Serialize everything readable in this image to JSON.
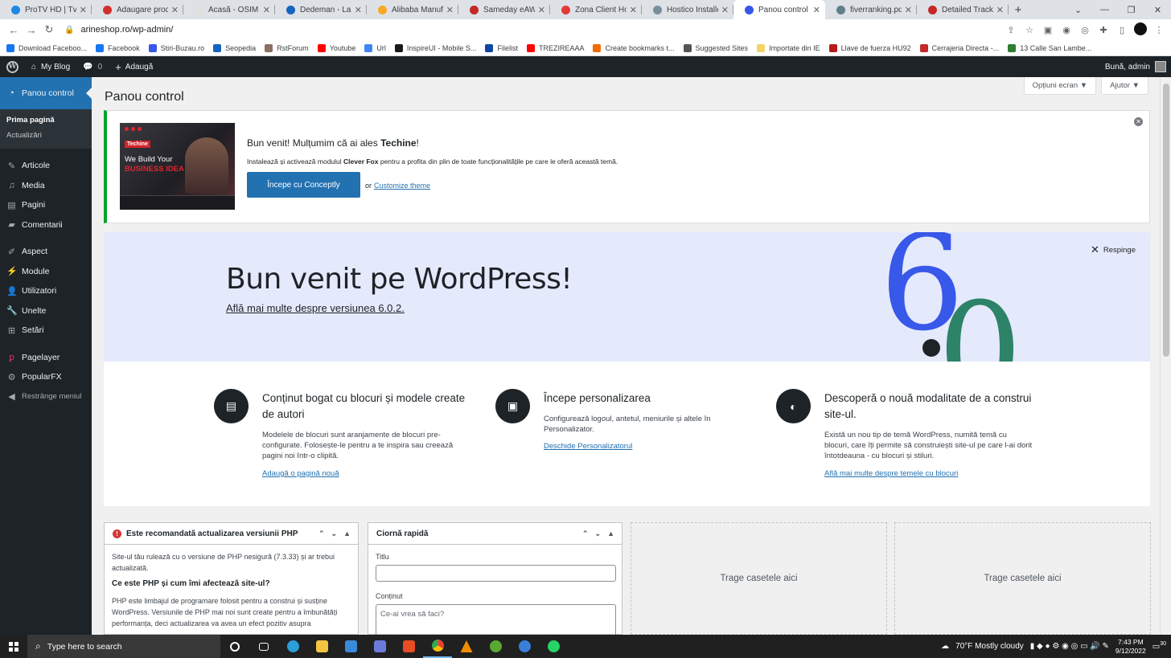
{
  "browser": {
    "tabs": [
      {
        "label": "ProTV HD | Tv Online",
        "color": "#1e88e5"
      },
      {
        "label": "Adaugare produs",
        "color": "#d32f2f"
      },
      {
        "label": "Acasă - OSIM - Of",
        "color": "#e0e0e0"
      },
      {
        "label": "Dedeman - Lamp",
        "color": "#1565c0"
      },
      {
        "label": "Alibaba Manufact",
        "color": "#f9a825"
      },
      {
        "label": "Sameday eAWB",
        "color": "#c62828"
      },
      {
        "label": "Zona Client Hostic",
        "color": "#e53935"
      },
      {
        "label": "Hostico Installer",
        "color": "#78909c"
      },
      {
        "label": "Panou control ‹ M",
        "color": "#3858e9",
        "active": true
      },
      {
        "label": "fiverranking.pdf",
        "color": "#607d8b"
      },
      {
        "label": "Detailed Tracking",
        "color": "#c62828"
      }
    ],
    "new_tab": "+",
    "url": "arineshop.ro/wp-admin/",
    "bookmarks": [
      {
        "label": "Download Faceboo...",
        "color": "#1877f2"
      },
      {
        "label": "Facebook",
        "color": "#1877f2"
      },
      {
        "label": "Stiri-Buzau.ro",
        "color": "#3858e9"
      },
      {
        "label": "Seopedia",
        "color": "#1565c0"
      },
      {
        "label": "RstForum",
        "color": "#8d6e63"
      },
      {
        "label": "Youtube",
        "color": "#ff0000"
      },
      {
        "label": "Url",
        "color": "#4285f4"
      },
      {
        "label": "InspireUI - Mobile S...",
        "color": "#1a1a1a"
      },
      {
        "label": "Filelist",
        "color": "#0d47a1"
      },
      {
        "label": "TREZIREAAA",
        "color": "#ff0000"
      },
      {
        "label": "Create bookmarks t...",
        "color": "#ef6c00"
      },
      {
        "label": "Suggested Sites",
        "color": "#555555"
      },
      {
        "label": "Importate din IE",
        "color": "#f6d365"
      },
      {
        "label": "Llave de fuerza HU92",
        "color": "#b71c1c"
      },
      {
        "label": "Cerrajeria Directa -...",
        "color": "#c62828"
      },
      {
        "label": "13 Calle San Lambe...",
        "color": "#2e7d32"
      }
    ]
  },
  "adminbar": {
    "site_name": "My Blog",
    "comments_count": "0",
    "new_label": "Adaugă",
    "greeting": "Bună, admin"
  },
  "sidebar": {
    "dashboard": "Panou control",
    "submenu": [
      "Prima pagină",
      "Actualizări"
    ],
    "items": [
      "Articole",
      "Media",
      "Pagini",
      "Comentarii",
      "Aspect",
      "Module",
      "Utilizatori",
      "Unelte",
      "Setări",
      "Pagelayer",
      "PopularFX",
      "Restrânge meniul"
    ]
  },
  "main": {
    "screen_options": "Opțiuni ecran ▼",
    "help": "Ajutor ▼",
    "title": "Panou control"
  },
  "notice": {
    "title_prefix": "Bun venit! Mulțumim că ai ales ",
    "theme_name": "Techine",
    "title_suffix": "!",
    "desc_prefix": "Instalează și activează modulul ",
    "plugin_name": "Clever Fox",
    "desc_suffix": " pentru a profita din plin de toate funcționalitățile pe care le oferă această temă.",
    "button": "Începe cu Conceptly",
    "or": "or",
    "link": "Customize theme",
    "image_logo": "Techine",
    "image_heading": "We Build Your",
    "image_heading2": "BUSINESS IDEA"
  },
  "welcome": {
    "heading": "Bun venit pe WordPress!",
    "sub_link": "Află mai multe despre versiunea 6.0.2.",
    "dismiss": "Respinge",
    "version_major": "6",
    "version_minor": "0"
  },
  "columns": [
    {
      "title": "Conținut bogat cu blocuri și modele create de autori",
      "desc": "Modelele de blocuri sunt aranjamente de blocuri pre-configurate. Folosește-le pentru a te inspira sau creează pagini noi într-o clipită.",
      "link": "Adaugă o pagină nouă"
    },
    {
      "title": "Începe personalizarea",
      "desc": "Configurează logoul, antetul, meniurile și altele în Personalizator.",
      "link": "Deschide Personalizatorul"
    },
    {
      "title": "Descoperă o nouă modalitate de a construi site-ul.",
      "desc": "Există un nou tip de temă WordPress, numită temă cu blocuri, care îți permite să construiești site-ul pe care l-ai dorit întotdeauna - cu blocuri și stiluri.",
      "link": "Află mai multe despre temele cu blocuri"
    }
  ],
  "php_box": {
    "title": "Este recomandată actualizarea versiunii PHP",
    "p1": "Site-ul tău rulează cu o versiune de PHP nesigură (7.3.33) și ar trebui actualizată.",
    "h": "Ce este PHP și cum îmi afectează site-ul?",
    "p2": "PHP este limbajul de programare folosit pentru a construi și susține WordPress. Versiunile de PHP mai noi sunt create pentru a îmbunătăți performanța, deci actualizarea va avea un efect pozitiv asupra"
  },
  "draft_box": {
    "title": "Ciornă rapidă",
    "title_label": "Titlu",
    "content_label": "Conținut",
    "content_placeholder": "Ce-ai vrea să faci?"
  },
  "dropzones": [
    "Trage casetele aici",
    "Trage casetele aici"
  ],
  "taskbar": {
    "search": "Type here to search",
    "weather": "70°F  Mostly cloudy",
    "time": "7:43 PM",
    "date": "9/12/2022",
    "notif_count": "30"
  }
}
